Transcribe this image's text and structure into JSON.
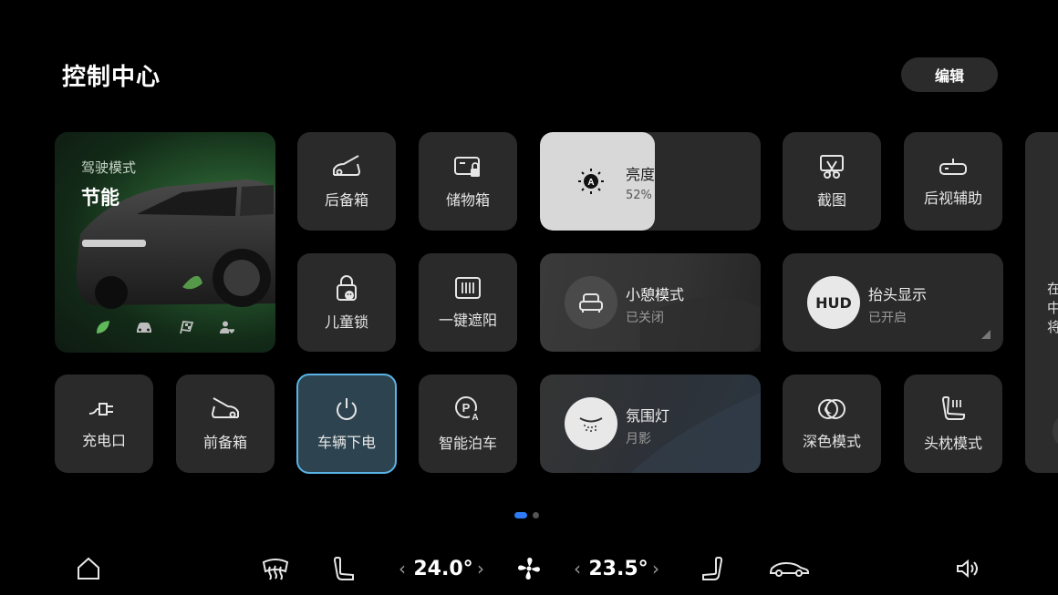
{
  "header": {
    "title": "控制中心",
    "edit_label": "编辑"
  },
  "drive_card": {
    "caption": "驾驶模式",
    "mode": "节能",
    "mode_icons": [
      "leaf-icon",
      "car-icon",
      "race-flag-icon",
      "person-heart-icon"
    ],
    "active_mode_color": "#5fb85a"
  },
  "tiles": {
    "trunk": "后备箱",
    "storage": "储物箱",
    "screenshot": "截图",
    "rear_view": "后视辅助",
    "child_lock": "儿童锁",
    "sunshade": "一键遮阳",
    "charge_port": "充电口",
    "frunk": "前备箱",
    "power_off": "车辆下电",
    "smart_parking": "智能泊车",
    "dark_mode": "深色模式",
    "headrest": "头枕模式"
  },
  "brightness": {
    "label": "亮度",
    "value": "52%",
    "level_percent": 52
  },
  "rest_mode": {
    "label": "小憩模式",
    "status": "已关闭"
  },
  "hud": {
    "icon_text": "HUD",
    "label": "抬头显示",
    "status": "已开启"
  },
  "ambient": {
    "label": "氛围灯",
    "status": "月影"
  },
  "side_card": {
    "chars": [
      "在",
      "中",
      "将"
    ]
  },
  "pager": {
    "active": 1,
    "total": 2,
    "accent": "#2f7bf5"
  },
  "bottom_bar": {
    "left_temp": "24.0°",
    "right_temp": "23.5°",
    "icons": [
      "home-icon",
      "rear-defrost-icon",
      "seat-icon",
      "fan-icon",
      "seat-right-icon",
      "car-side-icon",
      "volume-icon"
    ]
  }
}
